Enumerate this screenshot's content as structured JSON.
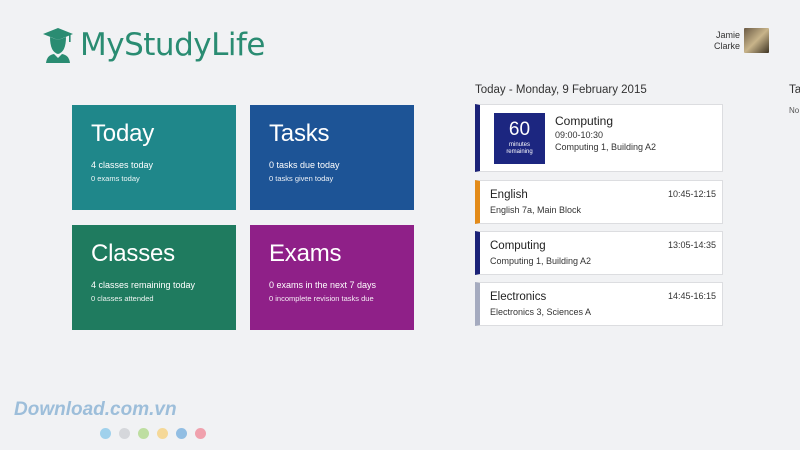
{
  "app": {
    "name": "MyStudyLife",
    "brand_color": "#2a8c72",
    "logo_icon": "graduation-cap-head-icon"
  },
  "user": {
    "first_name": "Jamie",
    "last_name": "Clarke"
  },
  "tiles": {
    "today": {
      "title": "Today",
      "line1": "4 classes today",
      "line2": "0 exams today",
      "color": "#1f878a"
    },
    "tasks": {
      "title": "Tasks",
      "line1": "0 tasks due today",
      "line2": "0 tasks given today",
      "color": "#1d5496"
    },
    "classes": {
      "title": "Classes",
      "line1": "4 classes remaining today",
      "line2": "0 classes attended",
      "color": "#1f7b5f"
    },
    "exams": {
      "title": "Exams",
      "line1": "0 exams in the next 7 days",
      "line2": "0 incomplete revision tasks due",
      "color": "#8f2088"
    }
  },
  "schedule": {
    "heading": "Today - Monday, 9 February 2015",
    "current": {
      "minutes": "60",
      "minutes_label_1": "minutes",
      "minutes_label_2": "remaining",
      "title": "Computing",
      "time": "09:00-10:30",
      "room": "Computing 1, Building A2",
      "color": "#1b2277"
    },
    "classes": [
      {
        "title": "English",
        "room": "English 7a, Main Block",
        "time": "10:45-12:15",
        "color": "#e38b19"
      },
      {
        "title": "Computing",
        "room": "Computing 1, Building A2",
        "time": "13:05-14:35",
        "color": "#1b2277"
      },
      {
        "title": "Electronics",
        "room": "Electronics 3, Sciences A",
        "time": "14:45-16:15",
        "color": "#a5abbf"
      }
    ]
  },
  "partial_column": {
    "heading": "Ta",
    "sub": "No"
  },
  "watermark": {
    "text": "Download.com.vn",
    "dot_colors": [
      "#7ec3e8",
      "#c9ccd0",
      "#a8d57e",
      "#f7cd70",
      "#6aa8dc",
      "#ef7f8e"
    ]
  }
}
